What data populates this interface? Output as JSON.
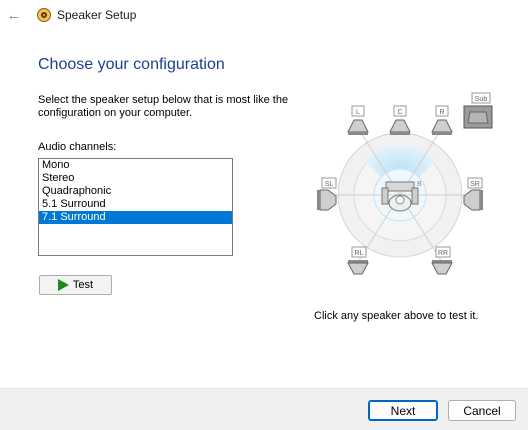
{
  "window": {
    "title": "Speaker Setup",
    "back_icon": "back-arrow-icon",
    "app_icon": "speaker-setup-icon"
  },
  "main": {
    "heading": "Choose your configuration",
    "instruction": "Select the speaker setup below that is most like the configuration on your computer.",
    "channels_label": "Audio channels:",
    "channels": [
      {
        "label": "Mono",
        "selected": false
      },
      {
        "label": "Stereo",
        "selected": false
      },
      {
        "label": "Quadraphonic",
        "selected": false
      },
      {
        "label": "5.1 Surround",
        "selected": false
      },
      {
        "label": "7.1 Surround",
        "selected": true
      }
    ],
    "test_label": "Test",
    "test_icon": "play-icon",
    "hint": "Click any speaker above to test it."
  },
  "speakers": {
    "front_left": "L",
    "front_center": "C",
    "front_right": "R",
    "subwoofer": "Sub",
    "side_left": "SL",
    "side_right": "SR",
    "rear_left": "RL",
    "rear_right": "RR"
  },
  "footer": {
    "next_label": "Next",
    "cancel_label": "Cancel"
  },
  "colors": {
    "heading": "#1c3f94",
    "selection": "#0078d7",
    "play": "#1e8a1e",
    "footer_bg": "#f0f0f0"
  }
}
